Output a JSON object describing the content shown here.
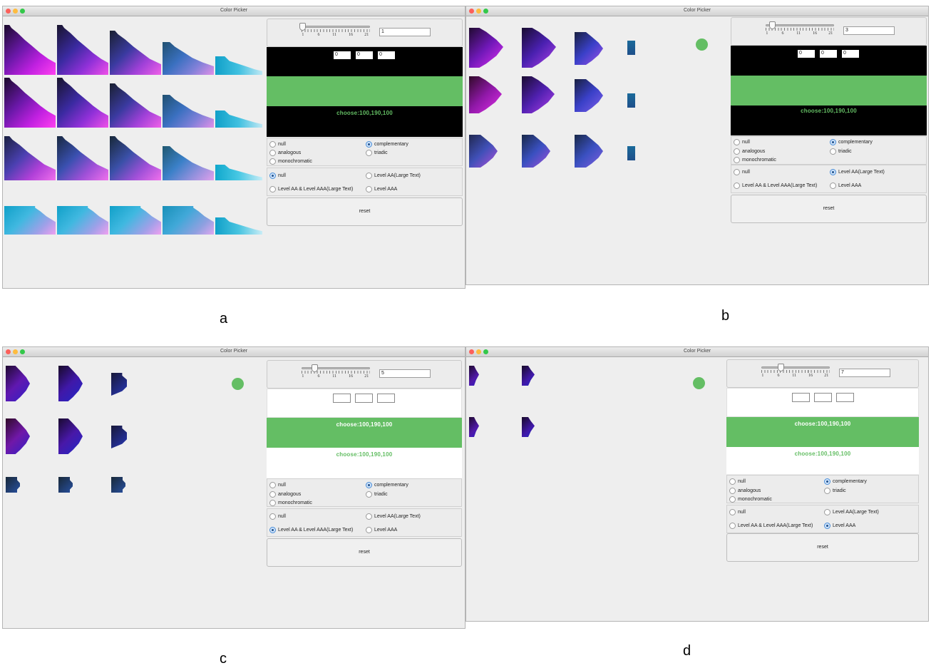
{
  "windows": [
    {
      "id": "a",
      "title": "Color Picker",
      "slider": {
        "value": 1,
        "ticks": [
          "1",
          "6",
          "11",
          "16",
          "21"
        ],
        "field": "1"
      },
      "swatch_mode": "dark",
      "rgb": [
        "0",
        "0",
        "0"
      ],
      "chosen_color": "#64be64",
      "choose_top": "",
      "choose_bottom": "choose:100,190,100",
      "scheme": {
        "options": [
          "null",
          "complementary",
          "analogous",
          "triadic",
          "monochromatic"
        ],
        "selected": "complementary"
      },
      "level": {
        "options": [
          "null",
          "Level AA(Large Text)",
          "Level AA & Level AAA(Large Text)",
          "Level AAA"
        ],
        "selected": "null"
      },
      "reset_label": "reset",
      "caption": "a"
    },
    {
      "id": "b",
      "title": "Color Picker",
      "slider": {
        "value": 3,
        "ticks": [
          "1",
          "6",
          "11",
          "16",
          "21"
        ],
        "field": "3"
      },
      "swatch_mode": "dark",
      "rgb": [
        "0",
        "0",
        "0"
      ],
      "chosen_color": "#64be64",
      "choose_top": "",
      "choose_bottom": "choose:100,190,100",
      "scheme": {
        "options": [
          "null",
          "complementary",
          "analogous",
          "triadic",
          "monochromatic"
        ],
        "selected": "complementary"
      },
      "level": {
        "options": [
          "null",
          "Level AA(Large Text)",
          "Level AA & Level AAA(Large Text)",
          "Level AAA"
        ],
        "selected": "Level AA(Large Text)"
      },
      "reset_label": "reset",
      "caption": "b"
    },
    {
      "id": "c",
      "title": "Color Picker",
      "slider": {
        "value": 5,
        "ticks": [
          "1",
          "6",
          "11",
          "16",
          "21"
        ],
        "field": "5"
      },
      "swatch_mode": "light",
      "rgb": [
        "",
        "",
        ""
      ],
      "chosen_color": "#64be64",
      "choose_top": "choose:100,190,100",
      "choose_bottom": "choose:100,190,100",
      "scheme": {
        "options": [
          "null",
          "complementary",
          "analogous",
          "triadic",
          "monochromatic"
        ],
        "selected": "complementary"
      },
      "level": {
        "options": [
          "null",
          "Level AA(Large Text)",
          "Level AA & Level AAA(Large Text)",
          "Level AAA"
        ],
        "selected": "Level AA & Level AAA(Large Text)"
      },
      "reset_label": "reset",
      "caption": "c"
    },
    {
      "id": "d",
      "title": "Color Picker",
      "slider": {
        "value": 7,
        "ticks": [
          "1",
          "6",
          "11",
          "16",
          "21"
        ],
        "field": "7"
      },
      "swatch_mode": "light",
      "rgb": [
        "",
        "",
        ""
      ],
      "chosen_color": "#64be64",
      "choose_top": "choose:100,190,100",
      "choose_bottom": "choose:100,190,100",
      "scheme": {
        "options": [
          "null",
          "complementary",
          "analogous",
          "triadic",
          "monochromatic"
        ],
        "selected": "complementary"
      },
      "level": {
        "options": [
          "null",
          "Level AA(Large Text)",
          "Level AA & Level AAA(Large Text)",
          "Level AAA"
        ],
        "selected": "Level AAA"
      },
      "reset_label": "reset",
      "caption": "d"
    }
  ],
  "colors": {
    "accent_green": "#64be64",
    "dark_band": "#000000",
    "radio_selected": "#4a8ed8"
  },
  "icons": [
    "window-close-icon",
    "window-minimize-icon",
    "window-zoom-icon",
    "radio-icon",
    "slider-thumb-icon",
    "color-dot-icon"
  ]
}
